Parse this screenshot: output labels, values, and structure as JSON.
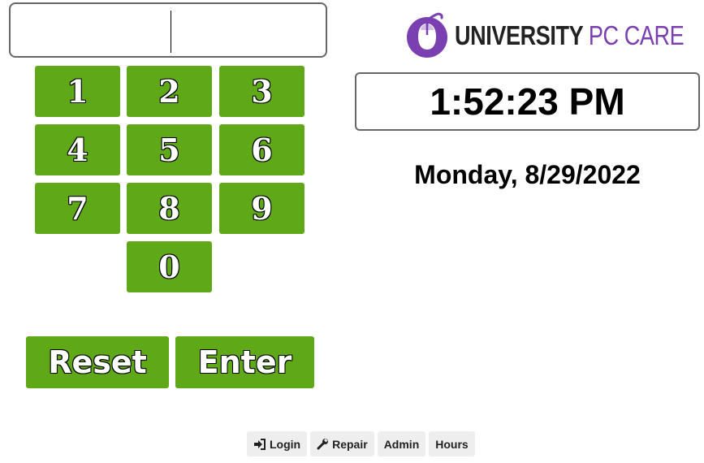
{
  "pin_input": {
    "value": ""
  },
  "keypad": {
    "keys": [
      "1",
      "2",
      "3",
      "4",
      "5",
      "6",
      "7",
      "8",
      "9",
      "0"
    ]
  },
  "actions": {
    "reset_label": "Reset",
    "enter_label": "Enter"
  },
  "logo": {
    "text_bold": "UNIVERSITY",
    "text_light": "PC CARE",
    "icon": "mouse-logo-icon",
    "colors": {
      "purple": "#7a3fb0",
      "dark": "#222222"
    }
  },
  "clock": {
    "time": "1:52:23 PM"
  },
  "date": {
    "text": "Monday, 8/29/2022"
  },
  "nav": {
    "items": [
      {
        "label": "Login",
        "icon": "sign-in-icon"
      },
      {
        "label": "Repair",
        "icon": "wrench-icon"
      },
      {
        "label": "Admin"
      },
      {
        "label": "Hours"
      }
    ]
  },
  "colors": {
    "key_green": "#5fa818",
    "border_gray": "#666666",
    "nav_bg": "#eeeeee"
  }
}
